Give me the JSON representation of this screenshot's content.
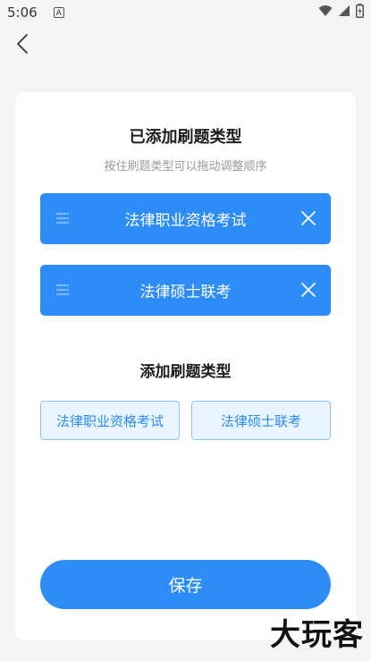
{
  "status_bar": {
    "time": "5:06",
    "notification_glyph": "A"
  },
  "page": {
    "title": "已添加刷题类型",
    "subtitle": "按住刷题类型可以拖动调整顺序",
    "added_items": [
      {
        "label": "法律职业资格考试"
      },
      {
        "label": "法律硕士联考"
      }
    ],
    "section_title": "添加刷题类型",
    "options": [
      {
        "label": "法律职业资格考试"
      },
      {
        "label": "法律硕士联考"
      }
    ],
    "save_label": "保存"
  },
  "watermark": "大玩客",
  "colors": {
    "accent": "#2d8cf6",
    "option_bg": "#e9f4fe",
    "option_border": "#8ec4f5",
    "background": "#f3f4f6"
  }
}
